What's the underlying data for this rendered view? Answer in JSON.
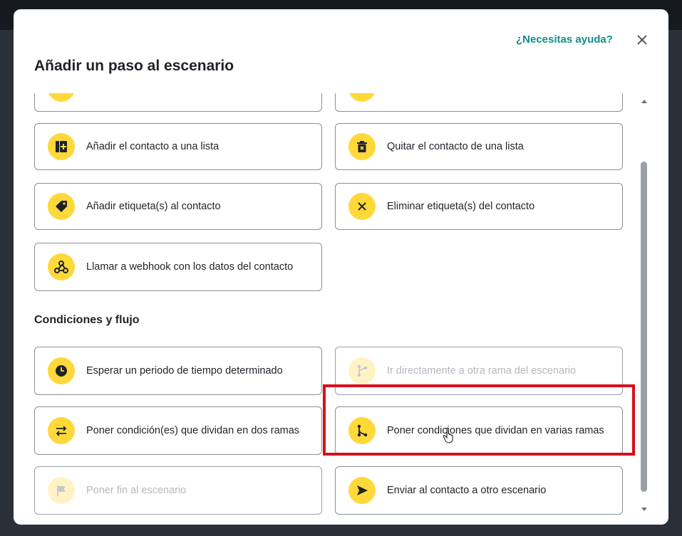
{
  "modal": {
    "help_link": "¿Necesitas ayuda?",
    "title": "Añadir un paso al escenario"
  },
  "cards": {
    "add_to_list": "Añadir el contacto a una lista",
    "remove_from_list": "Quitar el contacto de una lista",
    "add_tags": "Añadir etiqueta(s) al contacto",
    "remove_tags": "Eliminar etiqueta(s) del contacto",
    "webhook": "Llamar a webhook con los datos del contacto"
  },
  "sections": {
    "conditions_flow": "Condiciones y flujo"
  },
  "flow_cards": {
    "wait": "Esperar un periodo de tiempo determinado",
    "goto_branch": "Ir directamente a otra rama del escenario",
    "split_two": "Poner condición(es) que dividan en dos ramas",
    "split_multi": "Poner condiciones que dividan en varias ramas",
    "end": "Poner fin al escenario",
    "send_other": "Enviar al contacto a otro escenario"
  },
  "colors": {
    "accent": "#ffd83a",
    "accent_disabled": "#fff3c6",
    "link": "#0f8f8a",
    "highlight": "#d8101b"
  }
}
